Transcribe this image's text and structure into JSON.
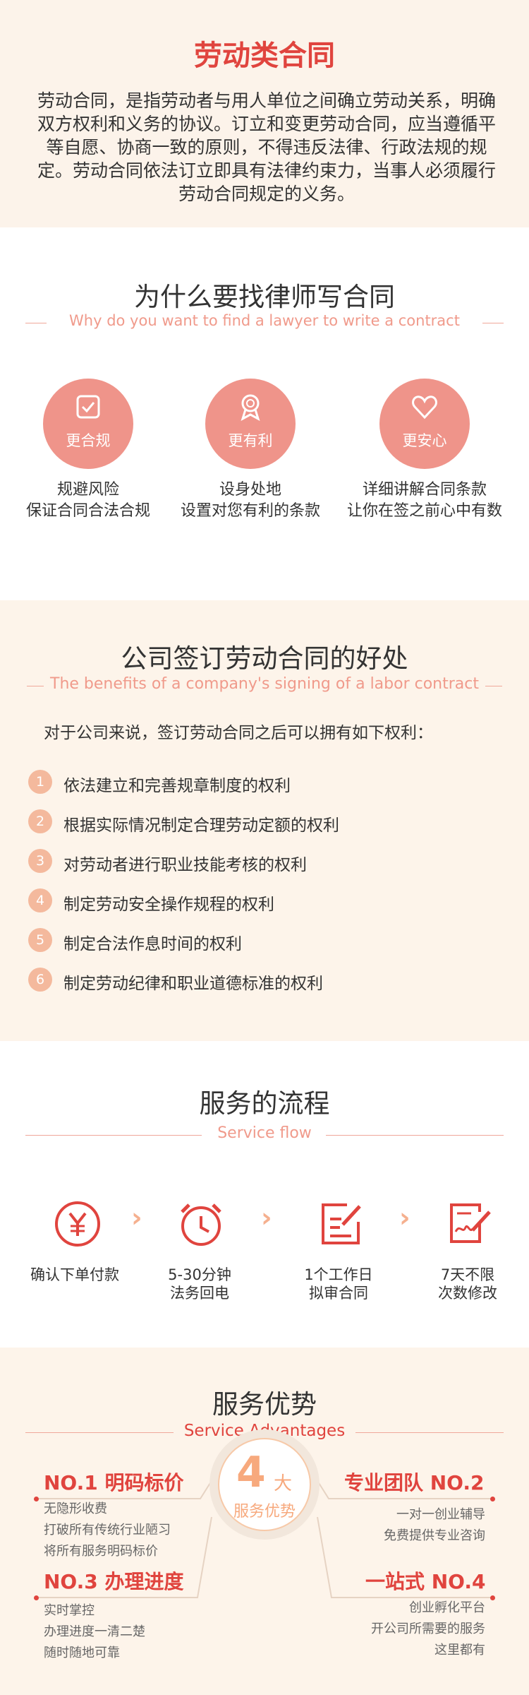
{
  "intro": {
    "title": "劳动类合同",
    "body": "劳动合同，是指劳动者与用人单位之间确立劳动关系，明确双方权利和义务的协议。订立和变更劳动合同，应当遵循平等自愿、协商一致的原则，不得违反法律、行政法规的规定。劳动合同依法订立即具有法律约束力，当事人必须履行劳动合同规定的义务。"
  },
  "why": {
    "title": "为什么要找律师写合同",
    "subtitle": "Why do you want to find a lawyer to write a contract",
    "features": [
      {
        "icon": "compliance-icon",
        "label": "更合规",
        "line1": "规避风险",
        "line2": "保证合同合法合规"
      },
      {
        "icon": "award-icon",
        "label": "更有利",
        "line1": "设身处地",
        "line2": "设置对您有利的条款"
      },
      {
        "icon": "heart-icon",
        "label": "更安心",
        "line1": "详细讲解合同条款",
        "line2": "让你在签之前心中有数"
      }
    ]
  },
  "benefits": {
    "title": "公司签订劳动合同的好处",
    "subtitle": "The benefits of a company's signing of a labor contract",
    "intro": "对于公司来说，签订劳动合同之后可以拥有如下权利：",
    "items": [
      {
        "num": "1",
        "text": "依法建立和完善规章制度的权利"
      },
      {
        "num": "2",
        "text": "根据实际情况制定合理劳动定额的权利"
      },
      {
        "num": "3",
        "text": "对劳动者进行职业技能考核的权利"
      },
      {
        "num": "4",
        "text": "制定劳动安全操作规程的权利"
      },
      {
        "num": "5",
        "text": "制定合法作息时间的权利"
      },
      {
        "num": "6",
        "text": "制定劳动纪律和职业道德标准的权利"
      }
    ]
  },
  "flow": {
    "title": "服务的流程",
    "subtitle": "Service flow",
    "steps": [
      {
        "icon": "yen-icon",
        "line1": "确认下单付款",
        "line2": ""
      },
      {
        "icon": "alarm-clock-icon",
        "line1": "5-30分钟",
        "line2": "法务回电"
      },
      {
        "icon": "edit-document-icon",
        "line1": "1个工作日",
        "line2": "拟审合同"
      },
      {
        "icon": "signature-icon",
        "line1": "7天不限",
        "line2": "次数修改"
      }
    ],
    "arrow": "›"
  },
  "advantages": {
    "title": "服务优势",
    "subtitle": "Service Advantages",
    "badge_num": "4",
    "badge_unit": "大",
    "badge_label": "服务优势",
    "items": [
      {
        "title": "NO.1 明码标价",
        "lines": [
          "无隐形收费",
          "打破所有传统行业陋习",
          "将所有服务明码标价"
        ]
      },
      {
        "title": "专业团队 NO.2",
        "lines": [
          "一对一创业辅导",
          "免费提供专业咨询"
        ]
      },
      {
        "title": "NO.3 办理进度",
        "lines": [
          "实时掌控",
          "办理进度一清二楚",
          "随时随地可靠"
        ]
      },
      {
        "title": "一站式 NO.4",
        "lines": [
          "创业孵化平台",
          "开公司所需要的服务",
          "这里都有"
        ]
      }
    ]
  },
  "colors": {
    "accent": "#e0443e",
    "peach": "#ef948a",
    "cream": "#fcf3ea"
  }
}
